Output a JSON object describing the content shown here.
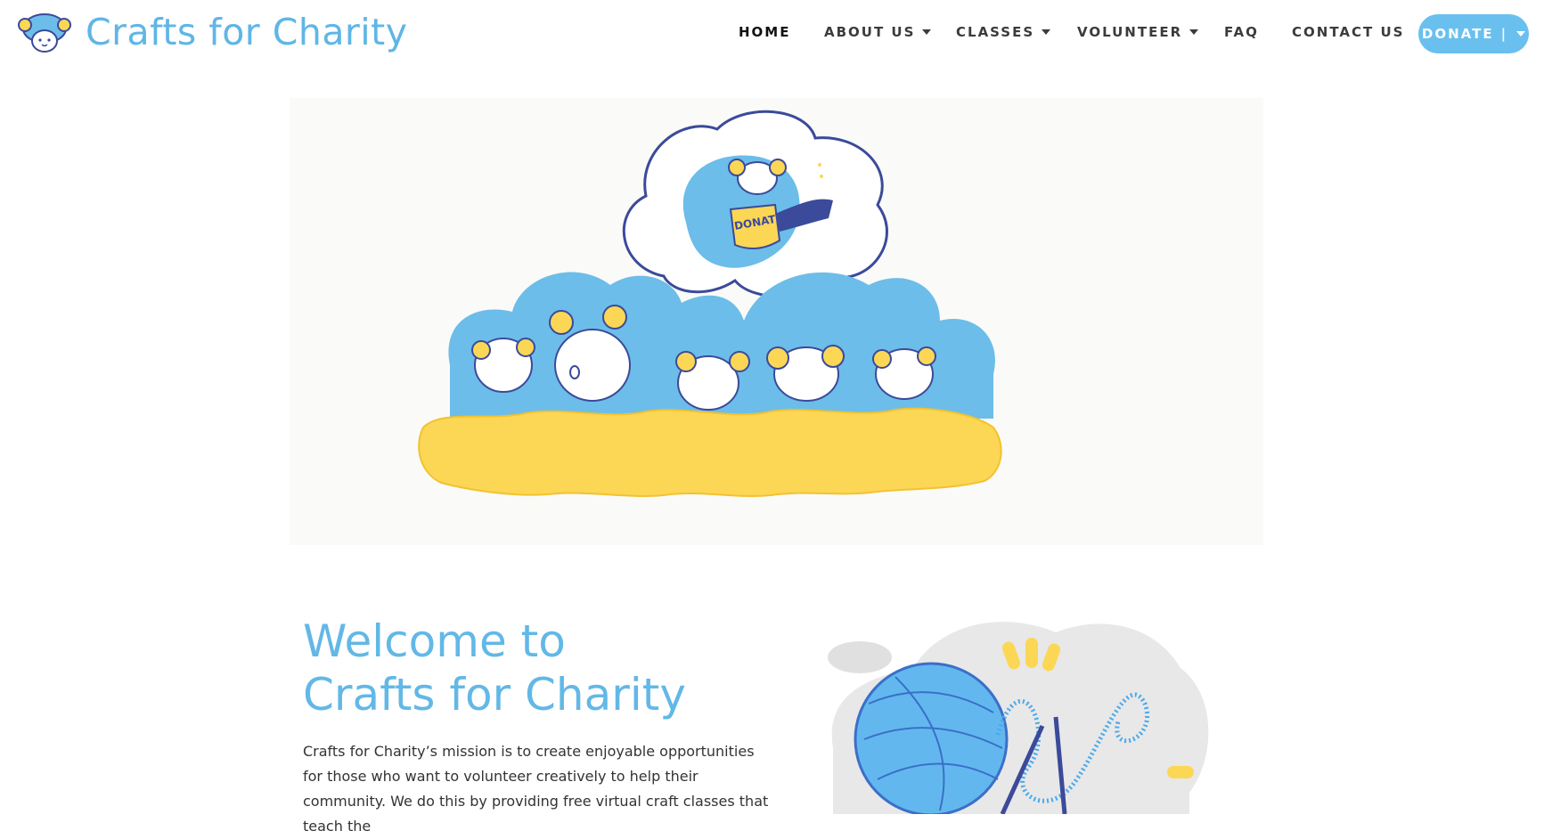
{
  "site": {
    "name": "Crafts for Charity"
  },
  "nav": {
    "home": "HOME",
    "about": "ABOUT US",
    "classes": "CLASSES",
    "volunteer": "VOLUNTEER",
    "faq": "FAQ",
    "contact": "CONTACT US",
    "donate": "DONATE",
    "donate_sep": "|"
  },
  "welcome": {
    "title_line1": "Welcome to",
    "title_line2": "Crafts for Charity",
    "mission": "Crafts for Charity’s mission is to create enjoyable opportunities for those who want to volunteer creatively to help their community. We do this by providing free virtual craft classes that teach the"
  },
  "hero": {
    "pot_label": "DONATE"
  },
  "colors": {
    "brand_blue": "#62b8e6",
    "button_blue": "#69c0ee",
    "yellow": "#fcd755",
    "ink": "#3b4a9a"
  }
}
